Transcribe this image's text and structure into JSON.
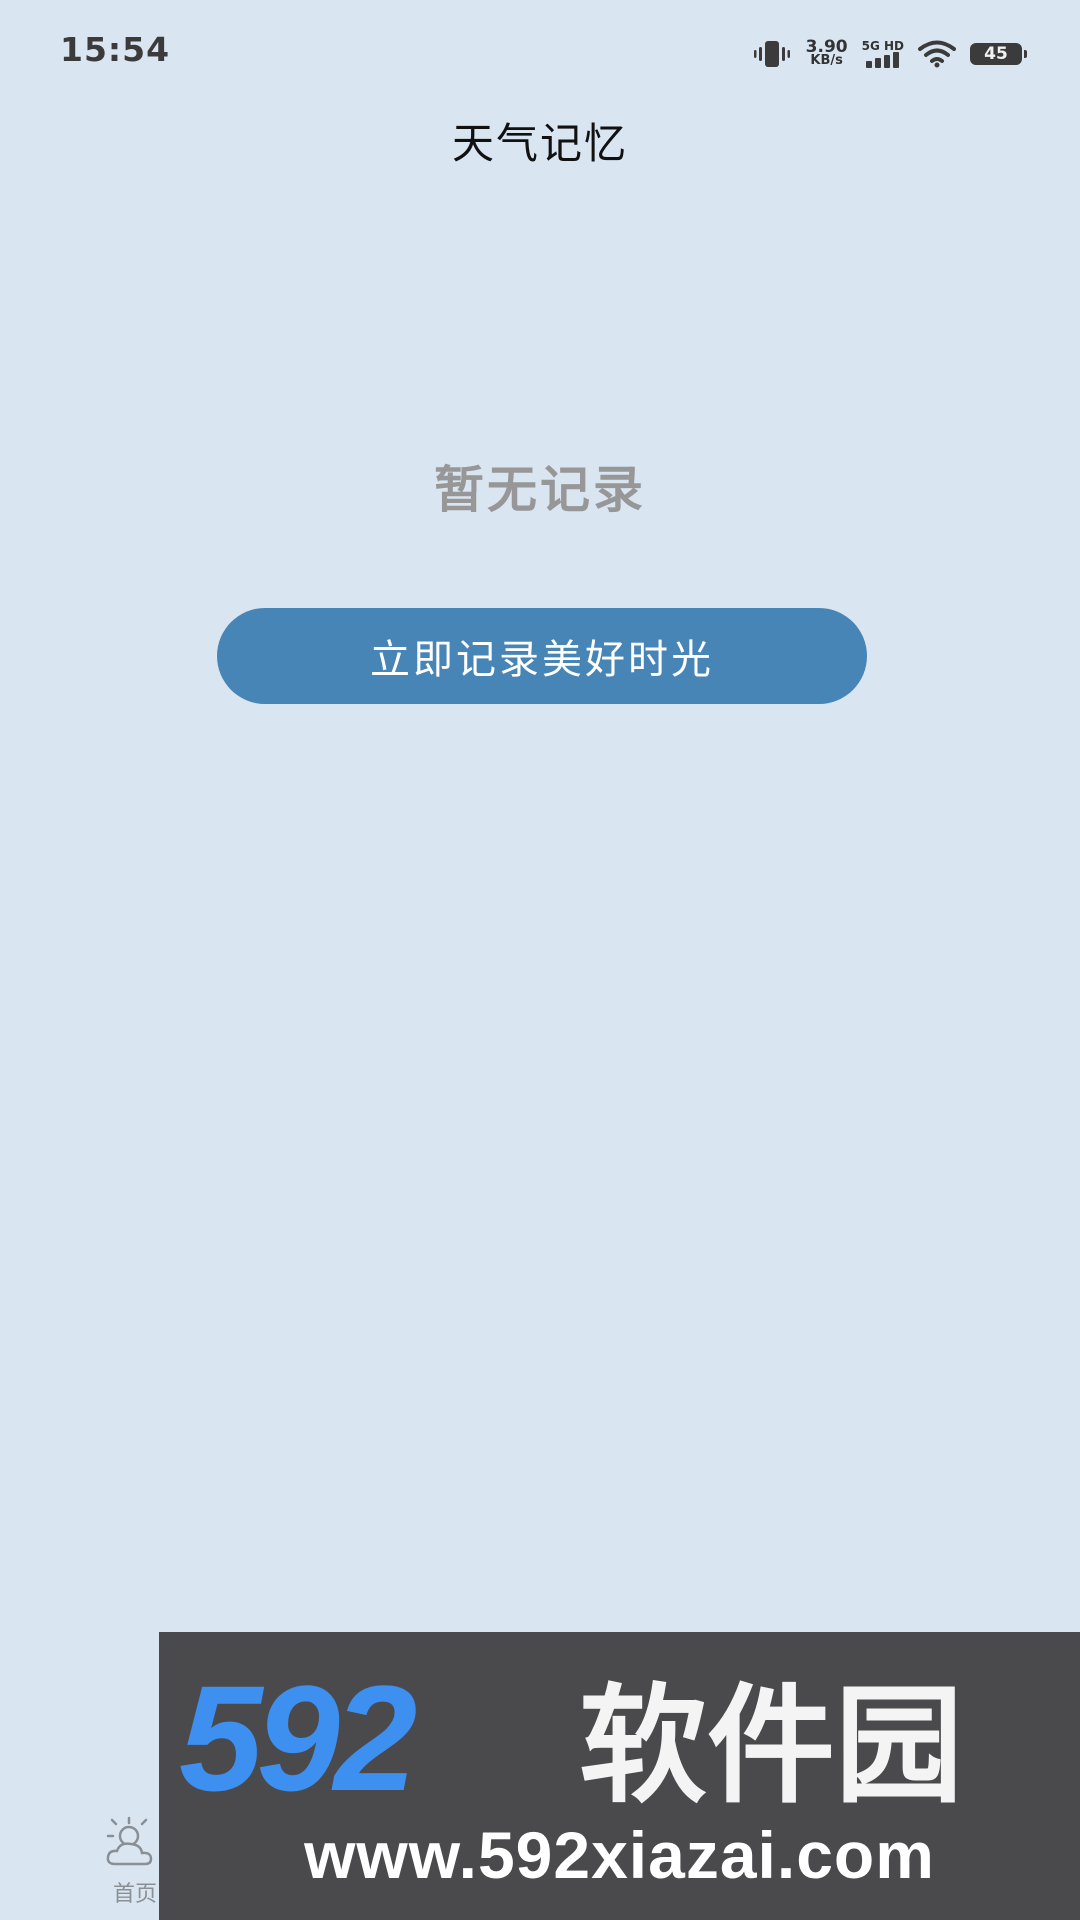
{
  "status_bar": {
    "time": "15:54",
    "net_speed_value": "3.90",
    "net_speed_unit": "KB/s",
    "signal_label": "5G HD",
    "battery_level": "45",
    "icons": [
      "vibrate-icon",
      "signal-icon",
      "wifi-icon",
      "battery-icon"
    ]
  },
  "header": {
    "title": "天气记忆"
  },
  "main": {
    "empty_text": "暂无记录",
    "record_button_label": "立即记录美好时光"
  },
  "bottom_nav": {
    "items": [
      {
        "label": "首页",
        "icon": "weather-icon"
      }
    ]
  },
  "watermark": {
    "brand": "592软件园",
    "url": "www.592xiazai.com"
  },
  "colors": {
    "background": "#d9e6f1",
    "button": "#4785b6",
    "empty_text": "#979797",
    "watermark_bg": "#4a4a4c",
    "watermark_accent": "#3d8ff0"
  }
}
